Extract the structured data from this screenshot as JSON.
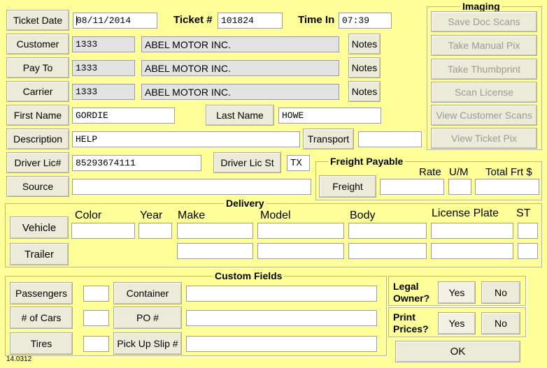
{
  "header": {
    "ticket_date_label": "Ticket Date",
    "ticket_date_value": "08/11/2014",
    "ticket_no_label": "Ticket #",
    "ticket_no_value": "101824",
    "time_in_label": "Time In",
    "time_in_value": "07:39"
  },
  "parties": {
    "customer_label": "Customer",
    "customer_code": "1333",
    "customer_name": "ABEL MOTOR INC.",
    "pay_to_label": "Pay To",
    "pay_to_code": "1333",
    "pay_to_name": "ABEL MOTOR INC.",
    "carrier_label": "Carrier",
    "carrier_code": "1333",
    "carrier_name": "ABEL MOTOR INC.",
    "notes_label": "Notes"
  },
  "person": {
    "first_name_label": "First Name",
    "first_name_value": "GORDIE",
    "last_name_label": "Last Name",
    "last_name_value": "HOWE",
    "description_label": "Description",
    "description_value": "HELP",
    "transport_label": "Transport",
    "transport_value": "",
    "driver_lic_label": "Driver Lic#",
    "driver_lic_value": "85293674111",
    "driver_lic_st_label": "Driver Lic St",
    "driver_lic_st_value": "TX",
    "source_label": "Source",
    "source_value": ""
  },
  "imaging": {
    "title": "Imaging",
    "buttons": [
      "Save Doc Scans",
      "Take Manual Pix",
      "Take Thumbprint",
      "Scan License",
      "View Customer Scans",
      "View Ticket Pix"
    ]
  },
  "freight": {
    "title": "Freight Payable",
    "rate_label": "Rate",
    "um_label": "U/M",
    "total_label": "Total Frt $",
    "button_label": "Freight",
    "rate_value": "",
    "um_value": "",
    "total_value": ""
  },
  "delivery": {
    "title": "Delivery",
    "columns": [
      "Color",
      "Year",
      "Make",
      "Model",
      "Body",
      "License Plate",
      "ST"
    ],
    "vehicle_label": "Vehicle",
    "trailer_label": "Trailer"
  },
  "custom": {
    "title": "Custom Fields",
    "passengers_label": "Passengers",
    "cars_label": "# of Cars",
    "tires_label": "Tires",
    "container_label": "Container",
    "po_label": "PO #",
    "pickup_label": "Pick Up Slip #"
  },
  "legal": {
    "legal_owner_label_1": "Legal",
    "legal_owner_label_2": "Owner?",
    "print_prices_label_1": "Print",
    "print_prices_label_2": "Prices?",
    "yes_label": "Yes",
    "no_label": "No"
  },
  "footer": {
    "ok_label": "OK",
    "version": "14.0312"
  }
}
